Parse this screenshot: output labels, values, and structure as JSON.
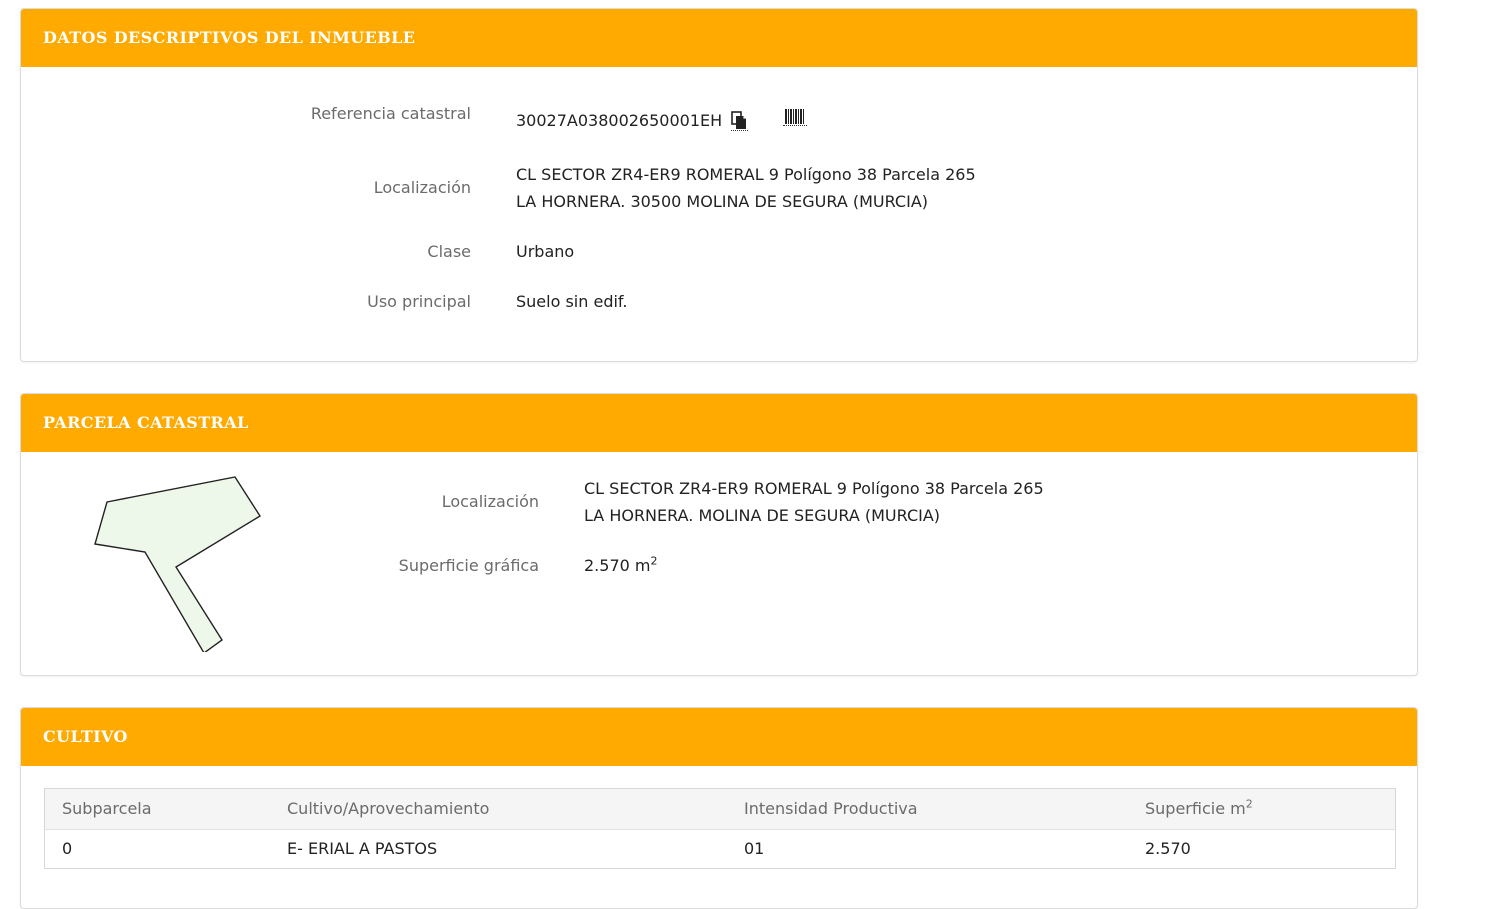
{
  "panels": {
    "descriptive": {
      "title": "DATOS DESCRIPTIVOS DEL INMUEBLE",
      "ref_label": "Referencia catastral",
      "ref_value": "30027A038002650001EH",
      "loc_label": "Localización",
      "loc_line1": "CL SECTOR ZR4-ER9 ROMERAL 9 Polígono 38 Parcela 265",
      "loc_line2": "LA HORNERA. 30500 MOLINA DE SEGURA (MURCIA)",
      "clase_label": "Clase",
      "clase_value": "Urbano",
      "uso_label": "Uso principal",
      "uso_value": "Suelo sin edif."
    },
    "parcela": {
      "title": "PARCELA CATASTRAL",
      "loc_label": "Localización",
      "loc_line1": "CL SECTOR ZR4-ER9 ROMERAL 9 Polígono 38 Parcela 265",
      "loc_line2": "LA HORNERA. MOLINA DE SEGURA (MURCIA)",
      "sup_label": "Superficie gráfica",
      "sup_value": "2.570 m",
      "sup_unit_exp": "2"
    },
    "cultivo": {
      "title": "CULTIVO",
      "columns": [
        "Subparcela",
        "Cultivo/Aprovechamiento",
        "Intensidad Productiva",
        "Superficie m"
      ],
      "column_exp": "2",
      "rows": [
        [
          "0",
          "E- ERIAL A PASTOS",
          "01",
          "2.570"
        ]
      ]
    }
  },
  "icons": {
    "copy": "copy-icon",
    "barcode": "barcode-icon"
  },
  "colors": {
    "header": "#ffaa00",
    "parcel_fill": "#eef8ea"
  }
}
